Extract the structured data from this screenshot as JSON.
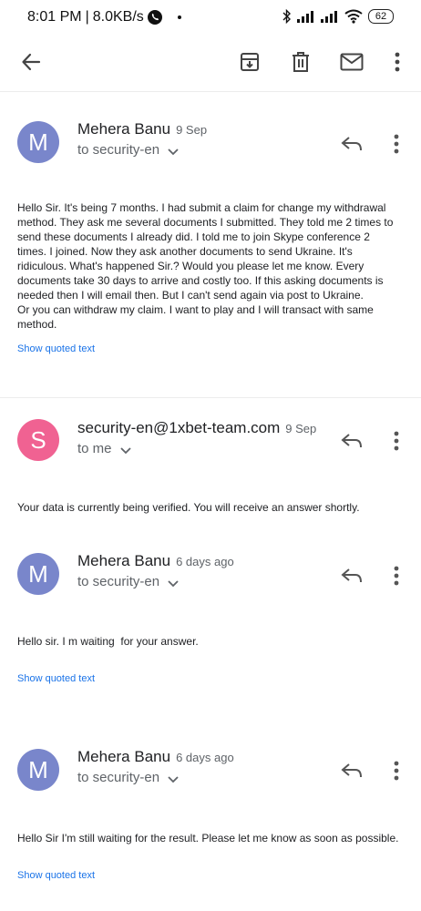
{
  "status": {
    "time": "8:01 PM",
    "speed": "8.0KB/s",
    "battery": "62"
  },
  "toolbar": {
    "back_icon": "arrow-left-icon",
    "archive_icon": "archive-icon",
    "delete_icon": "trash-icon",
    "mail_icon": "mail-icon",
    "more_icon": "more-vertical-icon"
  },
  "messages": [
    {
      "avatar_letter": "M",
      "avatar_color": "#7986cb",
      "sender": "Mehera Banu",
      "date": "9 Sep",
      "recipient": "to security-en",
      "body": "Hello Sir. It's being 7 months. I had submit a claim for change my withdrawal method. They ask me several documents I submitted. They told me 2 times to send these documents I already did. I told me to join Skype conference 2 times. I joined. Now they ask another documents to send Ukraine. It's ridiculous. What's happened Sir.? Would you please let me know. Every documents take 30 days to arrive and costly too. If this asking documents is needed then I will email then. But I can't send again via post to Ukraine.\nOr you can withdraw my claim. I want to play and I will transact with same method.",
      "quoted": "Show quoted text"
    },
    {
      "avatar_letter": "S",
      "avatar_color": "#f06292",
      "sender": "security-en@1xbet-team.com",
      "date": "9 Sep",
      "recipient": "to me",
      "body": "Your data is currently being verified. You will receive an answer shortly."
    },
    {
      "avatar_letter": "M",
      "avatar_color": "#7986cb",
      "sender": "Mehera Banu",
      "date": "6 days ago",
      "recipient": "to security-en",
      "body": "Hello sir. I m waiting  for your answer.",
      "quoted": "Show quoted text"
    },
    {
      "avatar_letter": "M",
      "avatar_color": "#7986cb",
      "sender": "Mehera Banu",
      "date": "6 days ago",
      "recipient": "to security-en",
      "body": "Hello Sir I'm still waiting for the result. Please let me know as soon as possible.",
      "quoted": "Show quoted text"
    }
  ]
}
